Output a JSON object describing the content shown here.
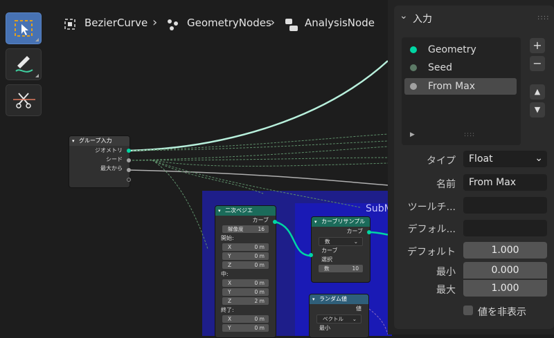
{
  "breadcrumb": {
    "item1": "BezierCurve",
    "item2": "GeometryNodes",
    "item3": "AnalysisNode",
    "separator": "›"
  },
  "toolbar": {
    "tools": [
      "select-box-tool",
      "annotate-tool",
      "cut-links-tool"
    ]
  },
  "canvas": {
    "frame_label": "SubM",
    "group_input_node": {
      "title": "グループ入力",
      "outputs": [
        "ジオメトリ",
        "シード",
        "最大から"
      ]
    },
    "quadratic_bezier_node": {
      "title": "二次ベジエ",
      "output": "カーブ",
      "resolution_label": "解像度",
      "resolution_value": "16",
      "start_label": "開始:",
      "mid_label": "中:",
      "end_label": "終了:",
      "start_xyz": [
        [
          "X",
          "0 m"
        ],
        [
          "Y",
          "0 m"
        ],
        [
          "Z",
          "0 m"
        ]
      ],
      "mid_xyz": [
        [
          "X",
          "0 m"
        ],
        [
          "Y",
          "0 m"
        ],
        [
          "Z",
          "2 m"
        ]
      ],
      "end_xyz": [
        [
          "X",
          "0 m"
        ],
        [
          "Y",
          "0 m"
        ]
      ]
    },
    "sample_curve_node": {
      "title": "カーブリサンプル",
      "output": "カーブ",
      "mode": "数",
      "input_curve": "カーブ",
      "selection": "選択",
      "count_label": "数",
      "count_value": "10"
    },
    "random_value_node": {
      "title": "ランダム値",
      "output": "値",
      "type": "ベクトル",
      "min_label": "最小"
    }
  },
  "panel": {
    "header": "入力",
    "sockets": [
      {
        "label": "Geometry",
        "color": "#00d6a3"
      },
      {
        "label": "Seed",
        "color": "#5c7a66"
      },
      {
        "label": "From Max",
        "color": "#a1a1a1"
      }
    ],
    "selected_index": 2,
    "type_label": "タイプ",
    "type_value": "Float",
    "name_label": "名前",
    "name_value": "From Max",
    "tooltip_label": "ツールチ...",
    "tooltip_value": "",
    "default_attr_label": "デフォル...",
    "default_attr_value": "",
    "default_label": "デフォルト",
    "default_value": "1.000",
    "min_label": "最小",
    "min_value": "0.000",
    "max_label": "最大",
    "max_value": "1.000",
    "hide_value_label": "値を非表示",
    "hide_value_checked": false
  },
  "colors": {
    "geometry_socket": "#00d6a3",
    "geometry_wire": "#b8f0dc",
    "float_wire": "#9aa59a",
    "seed_wire": "#5e8f6a",
    "node_header_geo": "#1b6b5a",
    "node_header_util": "#2f5f7a",
    "active_tool": "#4772b3"
  }
}
